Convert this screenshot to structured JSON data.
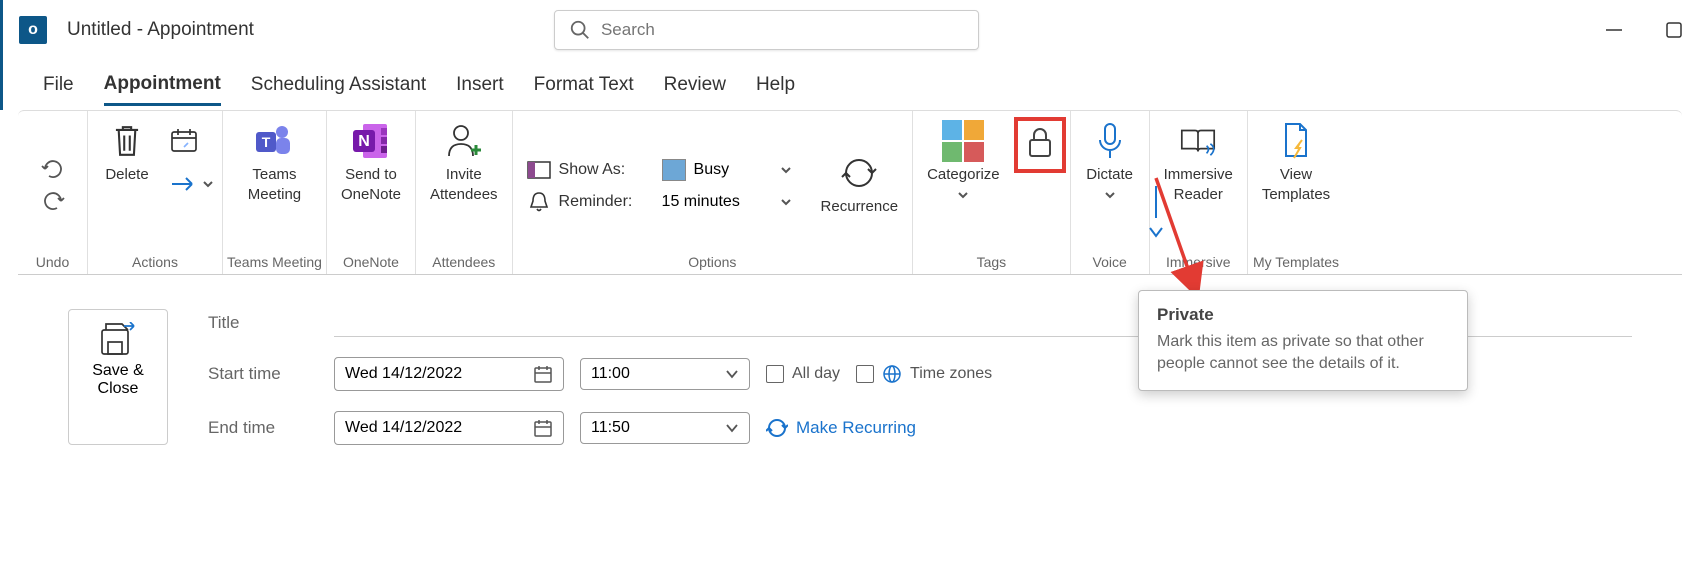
{
  "titlebar": {
    "app_initial": "o",
    "title": "Untitled  -  Appointment",
    "search_placeholder": "Search"
  },
  "tabs": {
    "file": "File",
    "appointment": "Appointment",
    "scheduling": "Scheduling Assistant",
    "insert": "Insert",
    "format": "Format Text",
    "review": "Review",
    "help": "Help"
  },
  "ribbon": {
    "undo_group": "Undo",
    "actions": {
      "delete": "Delete",
      "label": "Actions"
    },
    "teams": {
      "btn": "Teams\nMeeting",
      "label": "Teams Meeting"
    },
    "onenote": {
      "btn": "Send to\nOneNote",
      "label": "OneNote"
    },
    "attendees": {
      "btn": "Invite\nAttendees",
      "label": "Attendees"
    },
    "options": {
      "show_as": "Show As:",
      "show_as_value": "Busy",
      "reminder": "Reminder:",
      "reminder_value": "15 minutes",
      "recurrence": "Recurrence",
      "label": "Options"
    },
    "tags": {
      "categorize": "Categorize",
      "label": "Tags"
    },
    "voice": {
      "dictate": "Dictate",
      "label": "Voice"
    },
    "immersive": {
      "reader": "Immersive\nReader",
      "label": "Immersive"
    },
    "templates": {
      "view": "View\nTemplates",
      "label": "My Templates"
    }
  },
  "form": {
    "save_close": "Save & Close",
    "title_label": "Title",
    "start_label": "Start time",
    "end_label": "End time",
    "start_date": "Wed 14/12/2022",
    "start_time": "11:00",
    "end_date": "Wed 14/12/2022",
    "end_time": "11:50",
    "all_day": "All day",
    "time_zones": "Time zones",
    "make_recurring": "Make Recurring"
  },
  "tooltip": {
    "title": "Private",
    "desc": "Mark this item as private so that other people cannot see the details of it."
  }
}
